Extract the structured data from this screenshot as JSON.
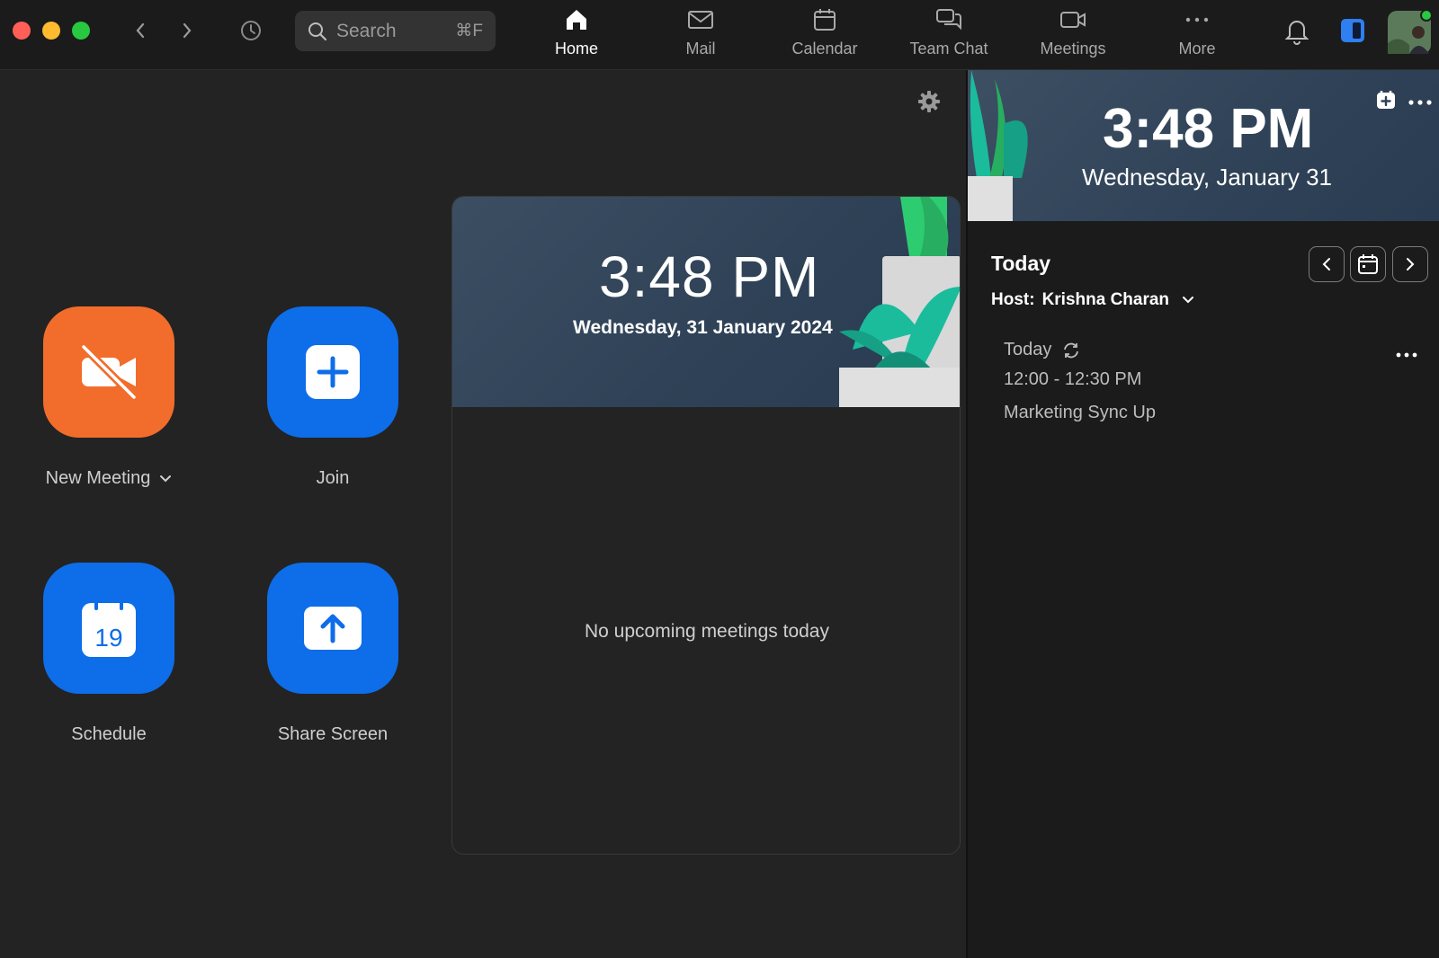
{
  "window": {
    "search_placeholder": "Search",
    "search_shortcut": "⌘F"
  },
  "tabs": [
    {
      "label": "Home",
      "icon": "home-icon",
      "active": true
    },
    {
      "label": "Mail",
      "icon": "mail-icon",
      "active": false
    },
    {
      "label": "Calendar",
      "icon": "calendar-icon",
      "active": false
    },
    {
      "label": "Team Chat",
      "icon": "chat-icon",
      "active": false
    },
    {
      "label": "Meetings",
      "icon": "video-icon",
      "active": false
    },
    {
      "label": "More",
      "icon": "more-icon",
      "active": false
    }
  ],
  "actions": {
    "new_meeting": "New Meeting",
    "join": "Join",
    "schedule": "Schedule",
    "schedule_day": "19",
    "share_screen": "Share Screen"
  },
  "center_card": {
    "time": "3:48 PM",
    "date": "Wednesday, 31 January 2024",
    "empty_message": "No upcoming meetings today"
  },
  "right_panel": {
    "time": "3:48 PM",
    "date": "Wednesday, January 31",
    "section_title": "Today",
    "host_label": "Host:",
    "host_name": "Krishna Charan",
    "meeting": {
      "day": "Today",
      "time": "12:00 - 12:30 PM",
      "title": "Marketing Sync Up"
    }
  },
  "colors": {
    "accent_blue": "#0e6de8",
    "new_meeting_orange": "#f26d2c",
    "status_green": "#28c840"
  }
}
